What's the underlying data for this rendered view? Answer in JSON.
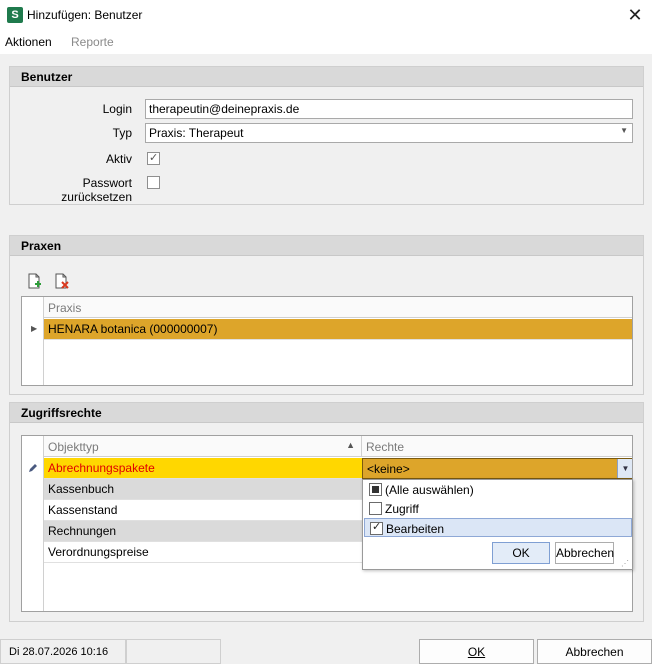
{
  "window": {
    "title": "Hinzufügen: Benutzer",
    "app_icon_letter": "S"
  },
  "menu": {
    "actions": "Aktionen",
    "reports": "Reporte"
  },
  "benutzer": {
    "header": "Benutzer",
    "login_label": "Login",
    "login_value": "therapeutin@deinepraxis.de",
    "typ_label": "Typ",
    "typ_value": "Praxis: Therapeut",
    "aktiv_label": "Aktiv",
    "aktiv_checked": true,
    "reset_label": "Passwort zurücksetzen",
    "reset_checked": false
  },
  "praxen": {
    "header": "Praxen",
    "column": "Praxis",
    "rows": [
      "HENARA botanica (000000007)"
    ]
  },
  "zugriff": {
    "header": "Zugriffsrechte",
    "col_objekttyp": "Objekttyp",
    "col_rechte": "Rechte",
    "rows": [
      {
        "objekttyp": "Abrechnungspakete",
        "rechte": "<keine>"
      },
      {
        "objekttyp": "Kassenbuch",
        "rechte": ""
      },
      {
        "objekttyp": "Kassenstand",
        "rechte": ""
      },
      {
        "objekttyp": "Rechnungen",
        "rechte": ""
      },
      {
        "objekttyp": "Verordnungspreise",
        "rechte": ""
      }
    ],
    "dropdown": {
      "items": [
        "(Alle auswählen)",
        "Zugriff",
        "Bearbeiten"
      ],
      "ok": "OK",
      "cancel": "Abbrechen"
    }
  },
  "status": {
    "datetime": "Di 28.07.2026 10:16"
  },
  "footer": {
    "ok": "OK",
    "cancel": "Abbrechen"
  },
  "colors": {
    "selection": "#dda52a",
    "highlight_row": "#ffd700",
    "highlight_text": "#e00000"
  }
}
